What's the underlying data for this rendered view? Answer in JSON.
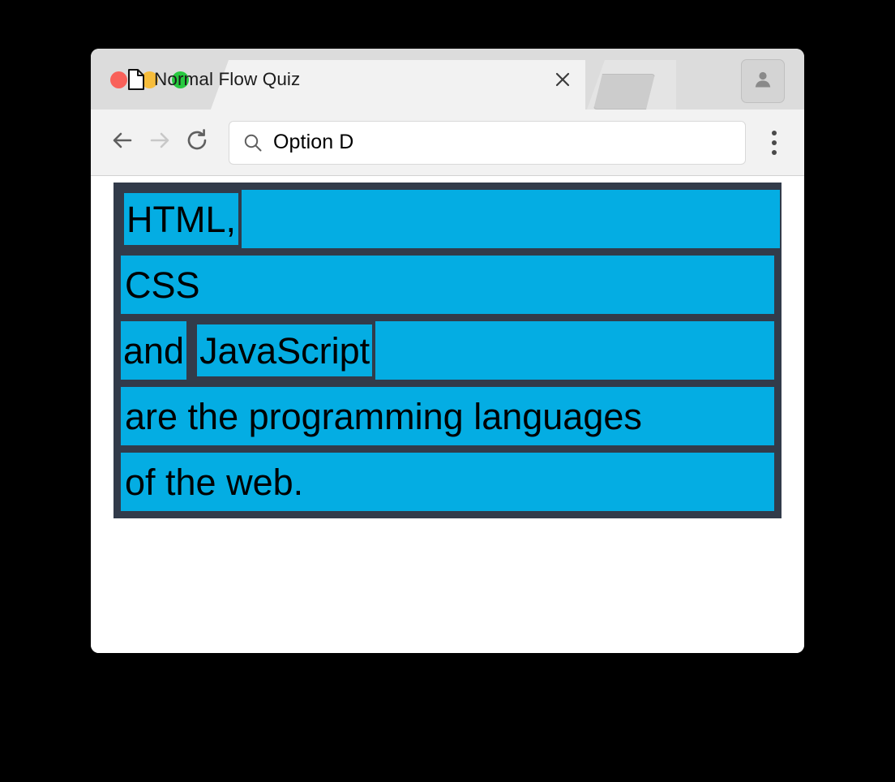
{
  "window": {
    "traffic_lights": [
      {
        "name": "close",
        "color": "#f8615a"
      },
      {
        "name": "minimize",
        "color": "#f7bd3b"
      },
      {
        "name": "zoom",
        "color": "#27c93f"
      }
    ]
  },
  "tabs": {
    "active": {
      "title": "Normal Flow Quiz",
      "icon": "page-document-icon",
      "close_icon": "close-icon"
    },
    "ghost": {
      "label": ""
    }
  },
  "profile": {
    "icon": "account-person-icon"
  },
  "toolbar": {
    "back": {
      "icon": "arrow-left-icon",
      "enabled": true
    },
    "forward": {
      "icon": "arrow-right-icon",
      "enabled": false
    },
    "reload": {
      "icon": "reload-icon",
      "enabled": true
    },
    "omnibox": {
      "icon": "search-icon",
      "value": "Option D",
      "placeholder": "Search or type a URL"
    },
    "menu": {
      "icon": "more-vertical-icon"
    }
  },
  "colors": {
    "highlight": "#04ade3",
    "outline": "#323b4a",
    "page_background": "#ffffff",
    "chrome_tabstrip": "#dcdcdc",
    "chrome_toolbar": "#f2f2f2",
    "desktop": "#000000"
  },
  "page": {
    "sentence": "HTML, CSS and JavaScript are the programming languages of the web.",
    "lines": [
      {
        "id": "line-1",
        "wide": true,
        "segments": [
          {
            "type": "word",
            "text": "HTML,",
            "bordered": true
          },
          {
            "type": "filler",
            "text": ""
          }
        ]
      },
      {
        "id": "line-2",
        "wide": false,
        "segments": [
          {
            "type": "full",
            "text": "CSS",
            "bordered": false
          }
        ]
      },
      {
        "id": "line-3",
        "wide": false,
        "segments": [
          {
            "type": "word",
            "text": "and",
            "bordered": false
          },
          {
            "type": "gap",
            "text": ""
          },
          {
            "type": "word",
            "text": "JavaScript",
            "bordered": true
          },
          {
            "type": "filler",
            "text": ""
          }
        ]
      },
      {
        "id": "line-4",
        "wide": false,
        "segments": [
          {
            "type": "full",
            "text": "are the programming languages",
            "bordered": false
          }
        ]
      },
      {
        "id": "line-5",
        "wide": false,
        "segments": [
          {
            "type": "full",
            "text": "of the web.",
            "bordered": false
          }
        ]
      }
    ]
  }
}
